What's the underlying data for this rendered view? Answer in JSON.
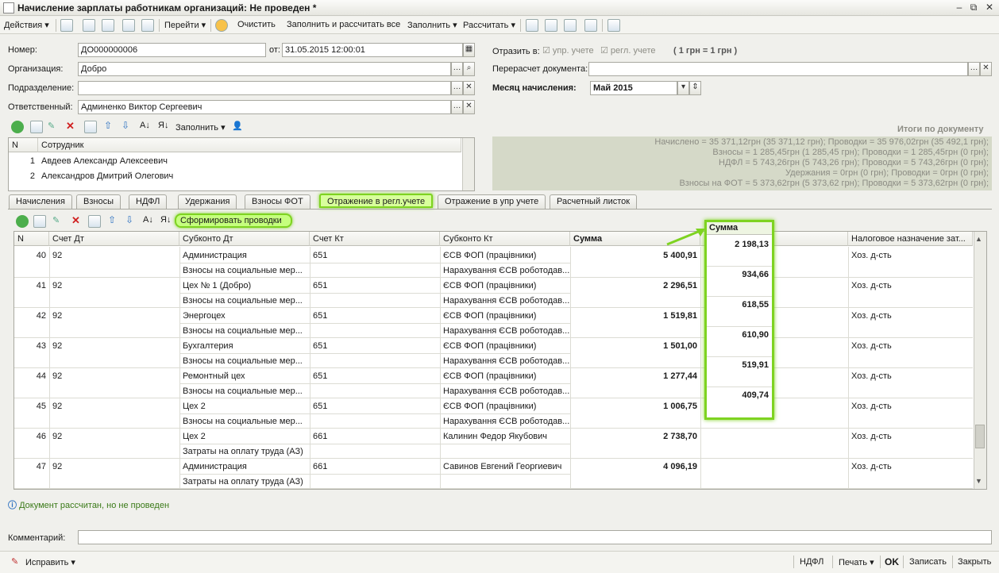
{
  "window": {
    "title": "Начисление зарплаты работникам организаций: Не проведен *",
    "min": "–",
    "max": "⧉",
    "close": "✕"
  },
  "toolbar": {
    "actions": "Действия",
    "goto": "Перейти",
    "clear": "Очистить",
    "fill_calc_all": "Заполнить и рассчитать все",
    "fill": "Заполнить",
    "calc": "Рассчитать"
  },
  "form": {
    "number_label": "Номер:",
    "number_value": "ДО000000006",
    "date_label": "от:",
    "date_value": "31.05.2015 12:00:01",
    "org_label": "Организация:",
    "org_value": "Добро",
    "dept_label": "Подразделение:",
    "dept_value": "",
    "resp_label": "Ответственный:",
    "resp_value": "Админенко Виктор Сергеевич",
    "reflect_label": "Отразить в:",
    "reflect_mgmt": "упр. учете",
    "reflect_reg": "регл. учете",
    "currency": "( 1 грн = 1 грн )",
    "recalc_label": "Перерасчет документа:",
    "recalc_value": "",
    "month_label": "Месяц начисления:",
    "month_value": "Май 2015",
    "emp_fill": "Заполнить"
  },
  "employees": {
    "headers": [
      "N",
      "Сотрудник"
    ],
    "rows": [
      {
        "n": "1",
        "name": "Авдеев Александр Алексеевич"
      },
      {
        "n": "2",
        "name": "Александров Дмитрий Олегович"
      }
    ]
  },
  "totals": {
    "title": "Итоги по документу",
    "lines": [
      "Начислено = 35 371,12грн (35 371,12 грн);   Проводки = 35 976,02грн (35 492,1 грн);",
      "Взносы = 1 285,45грн (1 285,45 грн);   Проводки = 1 285,45грн (0 грн);",
      "НДФЛ = 5 743,26грн (5 743,26 грн);   Проводки = 5 743,26грн (0 грн);",
      "Удержания = 0грн (0 грн);   Проводки = 0грн (0 грн);",
      "Взносы на ФОТ = 5 373,62грн (5 373,62 грн);   Проводки = 5 373,62грн (0 грн);"
    ]
  },
  "tabs": [
    "Начисления",
    "Взносы",
    "НДФЛ",
    "Удержания",
    "Взносы ФОТ",
    "Отражение в регл.учете",
    "Отражение в упр учете",
    "Расчетный листок"
  ],
  "postings": {
    "generate": "Сформировать проводки",
    "headers": [
      "N",
      "Счет Дт",
      "Субконто Дт",
      "Счет Кт",
      "Субконто Кт",
      "Сумма",
      "",
      "Налоговое назначение зат..."
    ],
    "rows": [
      {
        "n": "40",
        "dt": "92",
        "sub_dt1": "Администрация",
        "sub_dt2": "Взносы на социальные мер...",
        "kt": "651",
        "sub_kt1": "ЄСВ ФОП (працівники)",
        "sub_kt2": "Нарахування ЄСВ роботодав...",
        "sum": "5 400,91",
        "tax": "Хоз. д-сть"
      },
      {
        "n": "41",
        "dt": "92",
        "sub_dt1": "Цех № 1 (Добро)",
        "sub_dt2": "Взносы на социальные мер...",
        "kt": "651",
        "sub_kt1": "ЄСВ ФОП (працівники)",
        "sub_kt2": "Нарахування ЄСВ роботодав...",
        "sum": "2 296,51",
        "tax": "Хоз. д-сть"
      },
      {
        "n": "42",
        "dt": "92",
        "sub_dt1": "Энергоцех",
        "sub_dt2": "Взносы на социальные мер...",
        "kt": "651",
        "sub_kt1": "ЄСВ ФОП (працівники)",
        "sub_kt2": "Нарахування ЄСВ роботодав...",
        "sum": "1 519,81",
        "tax": "Хоз. д-сть"
      },
      {
        "n": "43",
        "dt": "92",
        "sub_dt1": "Бухгалтерия",
        "sub_dt2": "Взносы на социальные мер...",
        "kt": "651",
        "sub_kt1": "ЄСВ ФОП (працівники)",
        "sub_kt2": "Нарахування ЄСВ роботодав...",
        "sum": "1 501,00",
        "tax": "Хоз. д-сть"
      },
      {
        "n": "44",
        "dt": "92",
        "sub_dt1": "Ремонтный цех",
        "sub_dt2": "Взносы на социальные мер...",
        "kt": "651",
        "sub_kt1": "ЄСВ ФОП (працівники)",
        "sub_kt2": "Нарахування ЄСВ роботодав...",
        "sum": "1 277,44",
        "tax": "Хоз. д-сть"
      },
      {
        "n": "45",
        "dt": "92",
        "sub_dt1": "Цех 2",
        "sub_dt2": "Взносы на социальные мер...",
        "kt": "651",
        "sub_kt1": "ЄСВ ФОП (працівники)",
        "sub_kt2": "Нарахування ЄСВ роботодав...",
        "sum": "1 006,75",
        "tax": "Хоз. д-сть"
      },
      {
        "n": "46",
        "dt": "92",
        "sub_dt1": "Цех 2",
        "sub_dt2": "Затраты на оплату труда (АЗ)",
        "kt": "661",
        "sub_kt1": "Калинин Федор Якубович",
        "sub_kt2": "",
        "sum": "2 738,70",
        "tax": "Хоз. д-сть"
      },
      {
        "n": "47",
        "dt": "92",
        "sub_dt1": "Администрация",
        "sub_dt2": "Затраты на оплату труда (АЗ)",
        "kt": "661",
        "sub_kt1": "Савинов Евгений Георгиевич",
        "sub_kt2": "",
        "sum": "4 096,19",
        "tax": "Хоз. д-сть"
      }
    ]
  },
  "highlight": {
    "header": "Сумма",
    "values": [
      "2 198,13",
      "934,66",
      "618,55",
      "610,90",
      "519,91",
      "409,74"
    ]
  },
  "status": "Документ рассчитан, но не проведен",
  "comment_label": "Комментарий:",
  "comment_value": "",
  "bottom": {
    "fix": "Исправить",
    "ndfl": "НДФЛ",
    "print": "Печать",
    "ok": "OK",
    "save": "Записать",
    "close": "Закрыть"
  }
}
